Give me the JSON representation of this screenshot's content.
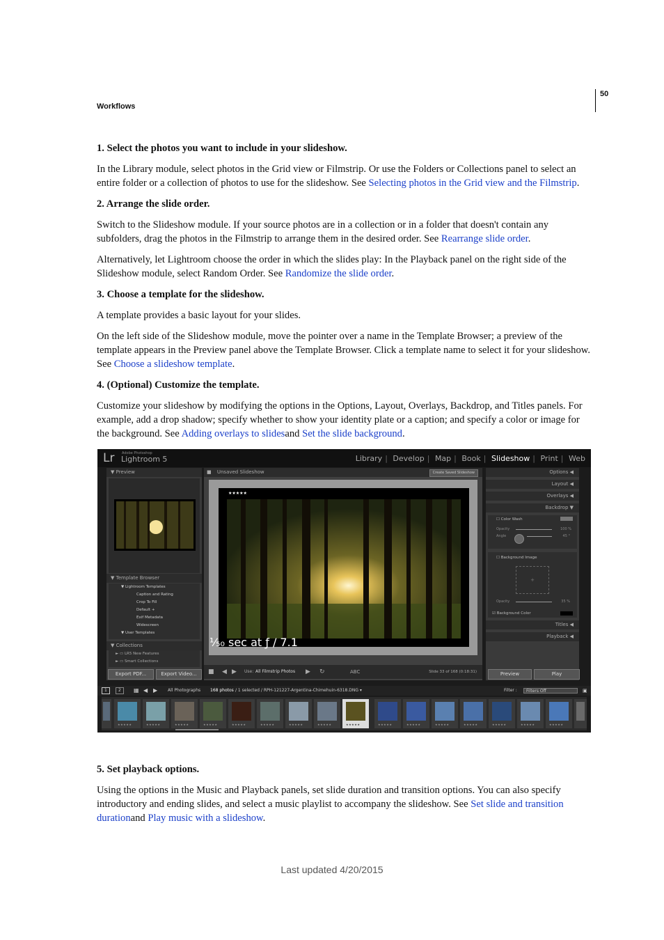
{
  "header": {
    "section": "Workflows",
    "page_number": "50"
  },
  "steps_part1": [
    {
      "heading": "1. Select the photos you want to include in your slideshow.",
      "paragraphs": [
        {
          "text": "In the Library module, select photos in the Grid view or Filmstrip. Or use the Folders or Collections panel to select an entire folder or a collection of photos to use for the slideshow. See ",
          "link": "Selecting photos in the Grid view and the Filmstrip",
          "after": "."
        }
      ]
    },
    {
      "heading": "2. Arrange the slide order.",
      "paragraphs": [
        {
          "text": "Switch to the Slideshow module. If your source photos are in a collection or in a folder that doesn't contain any subfolders, drag the photos in the Filmstrip to arrange them in the desired order. See ",
          "link": "Rearrange slide order",
          "after": "."
        },
        {
          "text": "Alternatively, let Lightroom choose the order in which the slides play: In the Playback panel on the right side of the Slideshow module, select Random Order. See ",
          "link": "Randomize the slide order",
          "after": "."
        }
      ]
    },
    {
      "heading": "3. Choose a template for the slideshow.",
      "paragraphs": [
        {
          "text": "A template provides a basic layout for your slides.",
          "link": "",
          "after": ""
        },
        {
          "text": "On the left side of the Slideshow module, move the pointer over a name in the Template Browser; a preview of the template appears in the Preview panel above the Template Browser. Click a template name to select it for your slideshow. See ",
          "link": "Choose a slideshow template",
          "after": "."
        }
      ]
    },
    {
      "heading": "4. (Optional) Customize the template.",
      "paragraphs": [
        {
          "text": "Customize your slideshow by modifying the options in the Options, Layout, Overlays, Backdrop, and Titles panels. For example, add a drop shadow; specify whether to show your identity plate or a caption; and specify a color or image for the background. See ",
          "link": "Adding overlays to slides",
          "mid": "and ",
          "link2": "Set the slide background",
          "after": "."
        }
      ]
    }
  ],
  "step5": {
    "heading": "5. Set playback options.",
    "text": "Using the options in the Music and Playback panels, set slide duration and transition options. You can also specify introductory and ending slides, and select a music playlist to accompany the slideshow. See ",
    "link": "Set slide and transition duration",
    "mid": "and ",
    "link2": "Play music with a slideshow",
    "after": "."
  },
  "footer": "Last updated 4/20/2015",
  "screenshot": {
    "logo_mark": "Lr",
    "logo_small": "Adobe Photoshop",
    "logo_name": "Lightroom 5",
    "modules": [
      "Library",
      "Develop",
      "Map",
      "Book",
      "Slideshow",
      "Print",
      "Web"
    ],
    "active_module": "Slideshow",
    "left_panel": {
      "preview_header": "Preview",
      "template_browser_header": "Template Browser",
      "templates": [
        "Lightroom Templates",
        "Caption and Rating",
        "Crop To Fill",
        "Default +",
        "Exif Metadata",
        "Widescreen",
        "User Templates"
      ],
      "collections_header": "Collections",
      "collections": [
        "LR5 New Features",
        "Smart Collections"
      ],
      "export_pdf": "Export PDF...",
      "export_video": "Export Video..."
    },
    "center": {
      "title": "Unsaved Slideshow",
      "create_button": "Create Saved Slideshow",
      "stars": "★★★★★",
      "caption": "¹⁄₅₀ sec at ƒ / 7.1",
      "use_label": "Use:",
      "use_value": "All Filmstrip Photos",
      "abc": "ABC",
      "slide_count": "Slide 33 of 168 (0:18:31)"
    },
    "right_panel": {
      "panels": [
        "Options",
        "Layout",
        "Overlays",
        "Backdrop"
      ],
      "color_wash": "Color Wash",
      "opacity": "Opacity",
      "opacity_value": "100 %",
      "angle": "Angle",
      "angle_value": "45 °",
      "background_image": "Background Image",
      "bg_opacity_value": "35 %",
      "background_color": "Background Color",
      "titles": "Titles",
      "playback": "Playback",
      "preview_btn": "Preview",
      "play_btn": "Play"
    },
    "filmstrip_bar": {
      "view1": "1",
      "view2": "2",
      "source": "All Photographs",
      "count": "168 photos",
      "selection": "/ 1 selected / RPH-121227-Argentina-Chimehuin-6318.DNG ▾",
      "filter_label": "Filter :",
      "filter_value": "Filters Off"
    },
    "colors": {
      "panel": "#3a3a3a",
      "dark": "#1b1b1b",
      "link": "#1a3fc9"
    }
  }
}
